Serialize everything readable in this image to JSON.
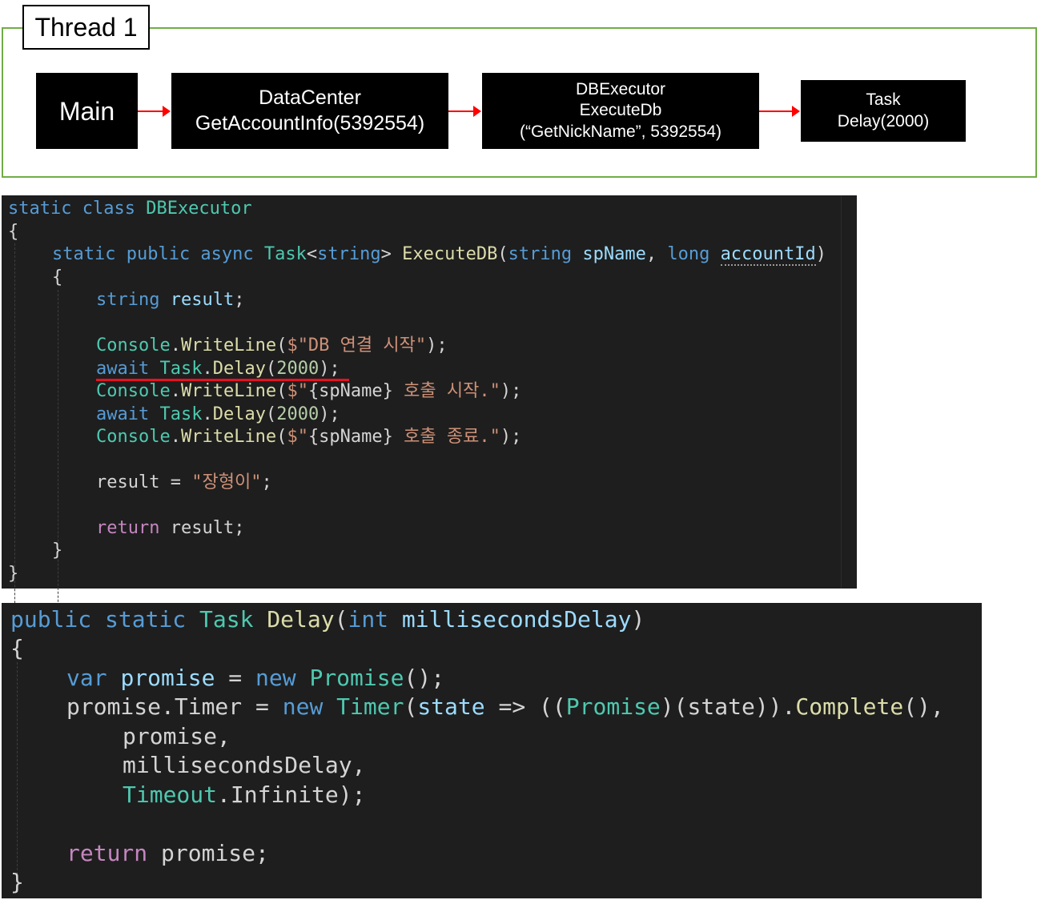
{
  "diagram": {
    "thread_label": "Thread 1",
    "nodes": {
      "main": "Main",
      "datacenter": [
        "DataCenter",
        "GetAccountInfo(5392554)"
      ],
      "dbexecutor": [
        "DBExecutor",
        "ExecuteDb",
        "(“GetNickName”, 5392554)"
      ],
      "task": [
        "Task",
        "Delay(2000)"
      ]
    },
    "colors": {
      "frame": "#70ad47",
      "arrow": "#ff0000",
      "node_bg": "#000000",
      "code_bg": "#1e1e1e",
      "highlight_underline": "#e81123"
    }
  },
  "code1": {
    "class_kw": "static class",
    "class_name": "DBExecutor",
    "brace_open": "{",
    "brace_close": "}",
    "method": {
      "modifiers": "static public async",
      "ret_type": "Task",
      "ret_arg_open": "<",
      "ret_arg": "string",
      "ret_arg_close": ">",
      "name": "ExecuteDB",
      "p1_type": "string",
      "p1_name": "spName",
      "p2_type": "long",
      "p2_name": "accountId"
    },
    "l_decl_type": "string",
    "l_decl_name": "result",
    "console": "Console",
    "writeline": "WriteLine",
    "str_dollar": "$",
    "str1": "\"DB 연결 시작\"",
    "await": "await",
    "task": "Task",
    "delay": "Delay",
    "delay_arg": "2000",
    "str2_a": "\"",
    "interp": "{spName}",
    "str2_b": " 호출 시작.\"",
    "str3_b": " 호출 종료.\"",
    "assign_lhs": "result",
    "assign_str": "\"장형이\"",
    "return_kw": "return",
    "return_val": "result"
  },
  "code2": {
    "sig_mods": "public static",
    "sig_type": "Task",
    "sig_name": "Delay",
    "param_type": "int",
    "param_name": "millisecondsDelay",
    "brace_open": "{",
    "brace_close": "}",
    "var_kw": "var",
    "var_name": "promise",
    "new_kw": "new",
    "promise_type": "Promise",
    "timer_lhs": "promise.Timer",
    "timer_type": "Timer",
    "state": "state",
    "cast_type": "Promise",
    "complete": "Complete",
    "arg_promise": "promise,",
    "arg_delay": "millisecondsDelay,",
    "timeout_type": "Timeout",
    "infinite": "Infinite",
    "return_kw": "return",
    "return_val": "promise;"
  }
}
